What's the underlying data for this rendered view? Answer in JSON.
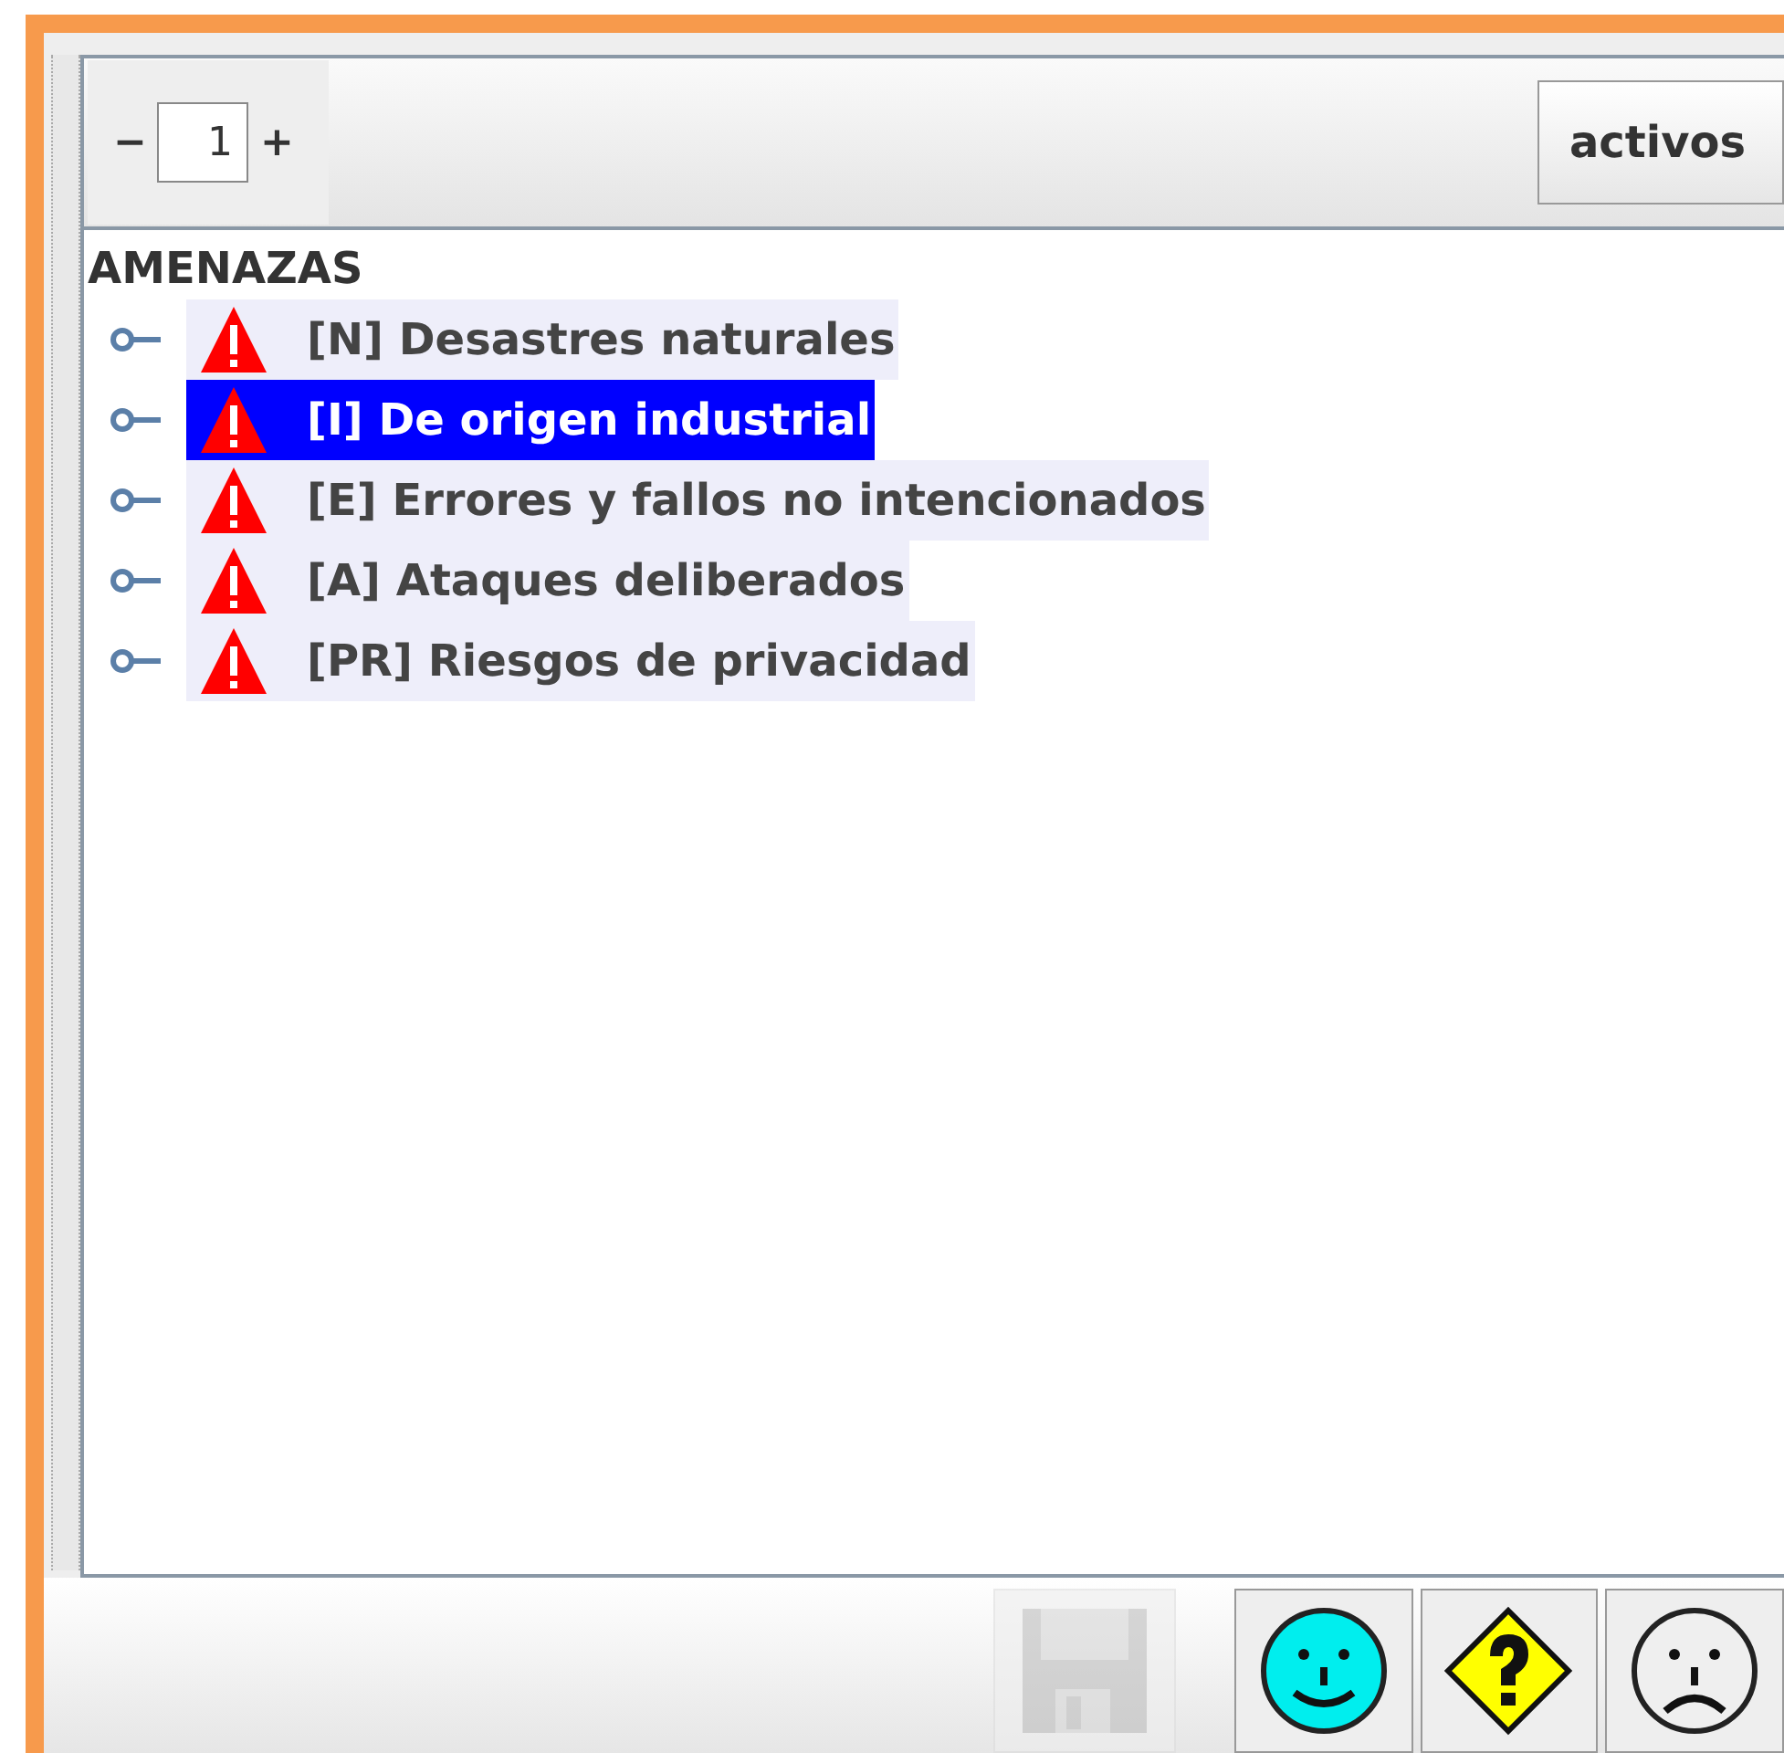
{
  "toolbar": {
    "decrement": "−",
    "page": "1",
    "increment": "+",
    "filter_button": "activos"
  },
  "tree": {
    "root": "AMENAZAS",
    "children": [
      {
        "label": "[N] Desastres naturales",
        "selected": false
      },
      {
        "label": "[I] De origen industrial",
        "selected": true
      },
      {
        "label": "[E] Errores y fallos no intencionados",
        "selected": false
      },
      {
        "label": "[A] Ataques deliberados",
        "selected": false
      },
      {
        "label": "[PR] Riesgos de privacidad",
        "selected": false
      }
    ]
  },
  "bottom_buttons": [
    {
      "kind": "save",
      "disabled": true
    },
    {
      "kind": "smile",
      "disabled": false
    },
    {
      "kind": "question",
      "disabled": false
    },
    {
      "kind": "sad",
      "disabled": false
    }
  ]
}
